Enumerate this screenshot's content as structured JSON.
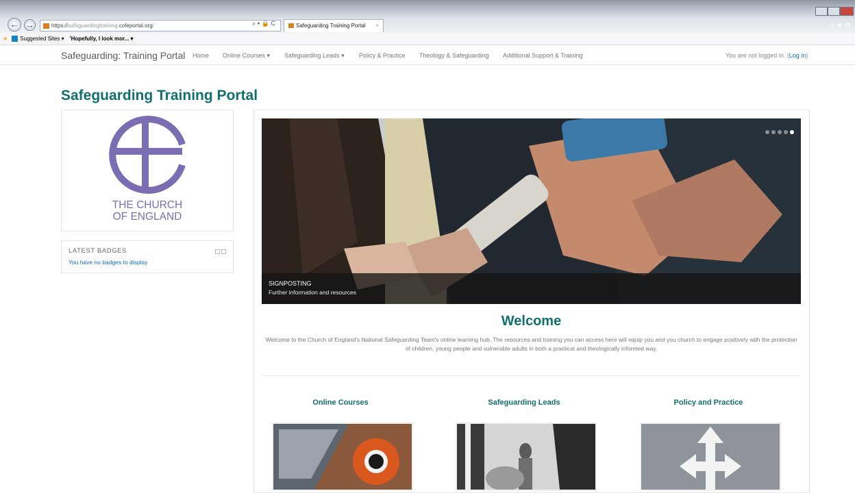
{
  "browser": {
    "url_scheme": "https://",
    "url_domain_dim": "safeguardingtraining.",
    "url_domain": "cofeportal.org",
    "url_path": "/",
    "url_tools": "⌕ ▾ 🔒 C",
    "tab_title": "Safeguarding Training Portal",
    "tab_close": "×",
    "right_icons": "⌂ ★ ⚙"
  },
  "favorites": {
    "suggested": "Suggested Sites ▾",
    "item2": "'Hopefully, I look mor... ▾"
  },
  "navbar": {
    "brand": "Safeguarding: Training Portal",
    "links": [
      "Home",
      "Online Courses ▾",
      "Safeguarding Leads ▾",
      "Policy & Practice",
      "Theology & Safeguarding",
      "Additional Support & Training"
    ],
    "login_text": "You are not logged in. (",
    "login_link": "Log in",
    "login_close": ")"
  },
  "page": {
    "title": "Safeguarding Training Portal"
  },
  "logo": {
    "line1": "THE CHURCH",
    "line2": "OF ENGLAND",
    "color": "#7a6db2"
  },
  "badges": {
    "title": "LATEST BADGES",
    "message": "You have no badges to display"
  },
  "slider": {
    "title": "SIGNPOSTING",
    "subtitle": "Further information and resources",
    "slide_count": 5,
    "active_slide": 5
  },
  "welcome": {
    "title": "Welcome",
    "text": "Welcome to the Church of England's National Safeguarding Team's online learning hub. The resources and training you can access here will equip you and you church to engage positively with the protection of children, young people and vulnerable adults in both a practical and theologically informed way."
  },
  "sections": [
    {
      "title": "Online Courses"
    },
    {
      "title": "Safeguarding Leads"
    },
    {
      "title": "Policy and Practice"
    }
  ],
  "colors": {
    "accent": "#11706e",
    "link": "#0f6cbf"
  }
}
